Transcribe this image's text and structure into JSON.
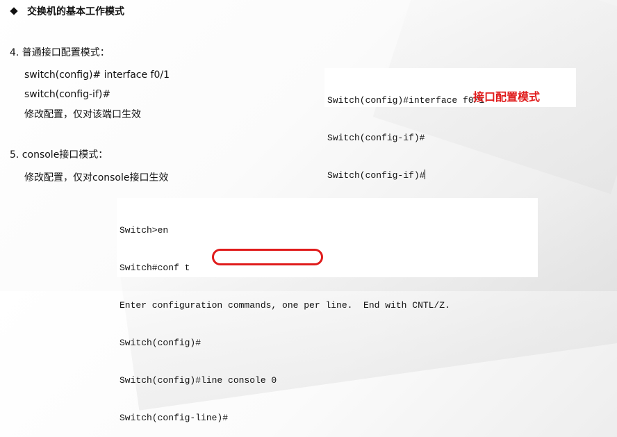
{
  "title": "交换机的基本工作模式",
  "section4": {
    "heading": "4.  普通接口配置模式：",
    "lines": [
      "switch(config)# interface f0/1",
      "switch(config-if)#",
      "修改配置，仅对该端口生效"
    ],
    "terminal": [
      "Switch(config)#interface f0/1",
      "Switch(config-if)#",
      "Switch(config-if)#"
    ],
    "annotation": "接口配置模式"
  },
  "section5": {
    "heading": "5.  console接口模式：",
    "lines": [
      "修改配置，仅对console接口生效"
    ],
    "terminal": [
      "Switch>en",
      "Switch#conf t",
      "Enter configuration commands, one per line.  End with CNTL/Z.",
      "Switch(config)#",
      "Switch(config)#line console 0",
      "Switch(config-line)#"
    ]
  },
  "colors": {
    "accent_red": "#e01b1b",
    "text": "#111111",
    "terminal_bg": "#ffffff"
  },
  "icons": {
    "bullet": "diamond-icon"
  }
}
